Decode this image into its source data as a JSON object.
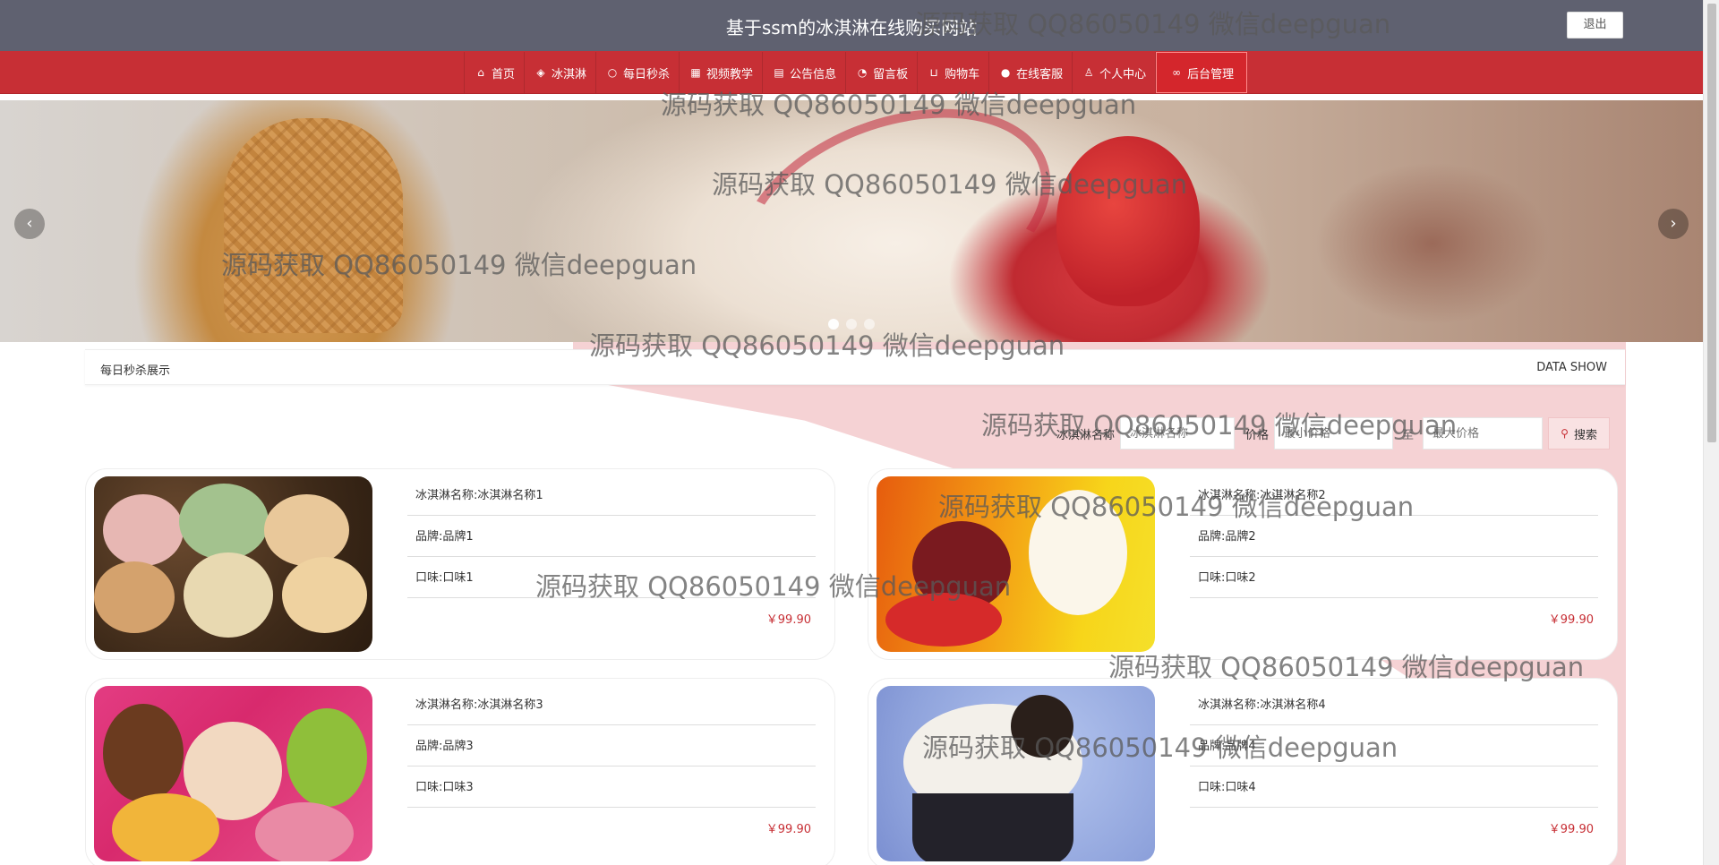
{
  "header": {
    "site_title": "基于ssm的冰淇淋在线购买网站",
    "logout_label": "退出"
  },
  "nav": {
    "items": [
      {
        "label": "首页",
        "icon": "home-icon"
      },
      {
        "label": "冰淇淋",
        "icon": "layers-icon"
      },
      {
        "label": "每日秒杀",
        "icon": "circle-icon"
      },
      {
        "label": "视频教学",
        "icon": "gift-icon"
      },
      {
        "label": "公告信息",
        "icon": "document-icon"
      },
      {
        "label": "留言板",
        "icon": "speedometer-icon"
      },
      {
        "label": "购物车",
        "icon": "cart-icon"
      },
      {
        "label": "在线客服",
        "icon": "service-icon"
      },
      {
        "label": "个人中心",
        "icon": "user-icon"
      },
      {
        "label": "后台管理",
        "icon": "link-icon"
      }
    ]
  },
  "banner": {
    "prev_symbol": "‹",
    "next_symbol": "›",
    "slide_count": 3,
    "active_slide": 1
  },
  "section": {
    "title": "每日秒杀展示",
    "subtitle": "DATA SHOW"
  },
  "search": {
    "name_label": "冰淇淋名称",
    "name_placeholder": "冰淇淋名称",
    "price_label": "价格",
    "min_placeholder": "最小价格",
    "dash": "至",
    "max_placeholder": "最大价格",
    "button_label": "搜索"
  },
  "products": [
    {
      "name": "冰淇淋名称:冰淇淋名称1",
      "brand": "品牌:品牌1",
      "flavor": "口味:口味1",
      "price": "￥99.90"
    },
    {
      "name": "冰淇淋名称:冰淇淋名称2",
      "brand": "品牌:品牌2",
      "flavor": "口味:口味2",
      "price": "￥99.90"
    },
    {
      "name": "冰淇淋名称:冰淇淋名称3",
      "brand": "品牌:品牌3",
      "flavor": "口味:口味3",
      "price": "￥99.90"
    },
    {
      "name": "冰淇淋名称:冰淇淋名称4",
      "brand": "品牌:品牌4",
      "flavor": "口味:口味4",
      "price": "￥99.90"
    }
  ],
  "watermark": {
    "text": "源码获取 QQ86050149 微信deepguan"
  },
  "colors": {
    "topbar": "#5f6170",
    "nav": "#c72f35",
    "accent_pink": "#f5d2d4",
    "price": "#c72f35"
  }
}
